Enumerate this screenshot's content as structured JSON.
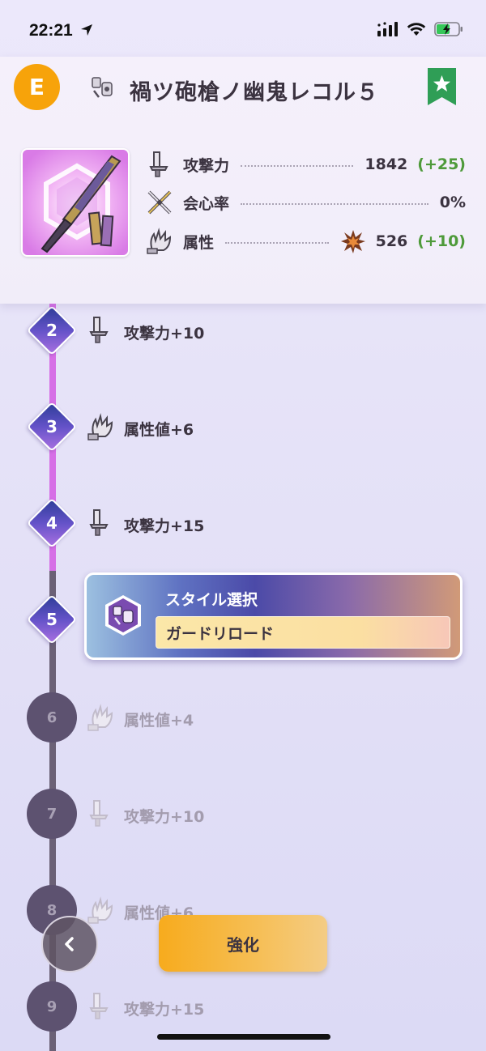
{
  "status_bar": {
    "time": "22:21"
  },
  "header": {
    "rank": "E",
    "weapon_name": "禍ツ砲槍ノ幽鬼レコル５",
    "weapon_type_icon": "gunlance-icon",
    "favorite_icon": "star-bookmark-icon"
  },
  "stats": [
    {
      "label": "攻撃力",
      "value": "1842",
      "bonus": "(+25)",
      "icon": "blade-icon"
    },
    {
      "label": "会心率",
      "value": "0%",
      "bonus": "",
      "icon": "crossed-swords-icon"
    },
    {
      "label": "属性",
      "value": "526",
      "bonus": "(+10)",
      "icon": "element-icon",
      "element_icon": "fire-burst-icon"
    }
  ],
  "upgrades": [
    {
      "level": "2",
      "label": "攻撃力+10",
      "icon": "blade-icon",
      "state": "done"
    },
    {
      "level": "3",
      "label": "属性値+6",
      "icon": "element-icon",
      "state": "done"
    },
    {
      "level": "4",
      "label": "攻撃力+15",
      "icon": "blade-icon",
      "state": "done"
    },
    {
      "level": "5",
      "label": "",
      "icon": "",
      "state": "current"
    },
    {
      "level": "6",
      "label": "属性値+4",
      "icon": "element-icon",
      "state": "locked"
    },
    {
      "level": "7",
      "label": "攻撃力+10",
      "icon": "blade-icon",
      "state": "locked"
    },
    {
      "level": "8",
      "label": "属性値+6",
      "icon": "element-icon",
      "state": "locked"
    },
    {
      "level": "9",
      "label": "攻撃力+15",
      "icon": "blade-icon",
      "state": "locked"
    }
  ],
  "style_select": {
    "title": "スタイル選択",
    "value": "ガードリロード",
    "icon": "gunlance-style-icon"
  },
  "buttons": {
    "back": "‹",
    "enhance": "強化"
  },
  "colors": {
    "rank_badge": "#f7a30a",
    "bonus_green": "#4e9a3a",
    "track_done": "#d66fe6",
    "track_locked": "#6b6176",
    "enhance_button": "#f7ab1d",
    "favorite": "#2f9e56"
  }
}
